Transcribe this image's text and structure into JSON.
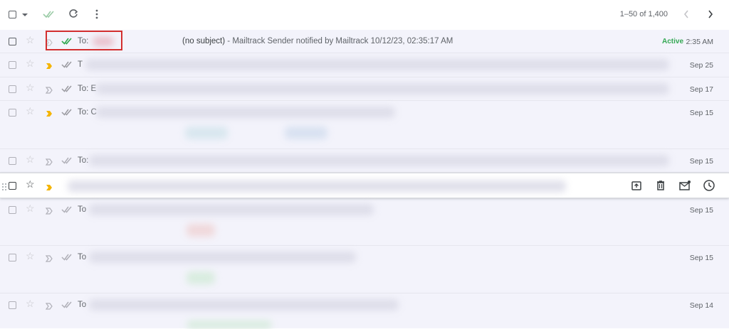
{
  "toolbar": {
    "icons": [
      "select-all-checkbox",
      "select-caret",
      "mark-read-icon",
      "refresh-icon",
      "more-vert-icon"
    ],
    "pagination": "1–50 of 1,400",
    "prev_icon": "chevron-left-icon",
    "next_icon": "chevron-right-icon"
  },
  "rows": [
    {
      "to": "To:",
      "subject": "(no subject)",
      "snippet": " - Mailtrack Sender notified by Mailtrack 10/12/23, 02:35:17 AM",
      "status": "Active",
      "date": "2:35 AM",
      "important": false,
      "read_check_color": "#34a853"
    },
    {
      "to": "T",
      "date": "Sep 25",
      "important": true
    },
    {
      "to": "To: E",
      "date": "Sep 17",
      "important": false
    },
    {
      "to": "To: C",
      "date": "Sep 15",
      "important": true
    },
    {
      "to": "To:",
      "date": "Sep 15",
      "important": false
    },
    {
      "to": "",
      "date": "",
      "important": true
    },
    {
      "to": "To",
      "date": "Sep 15",
      "important": false
    },
    {
      "to": "To",
      "date": "Sep 15",
      "important": false
    },
    {
      "to": "To",
      "date": "Sep 14",
      "important": false
    }
  ],
  "colors": {
    "accent_red": "#d32f2f",
    "important_yellow": "#f4b400",
    "active_green": "#34a853"
  }
}
